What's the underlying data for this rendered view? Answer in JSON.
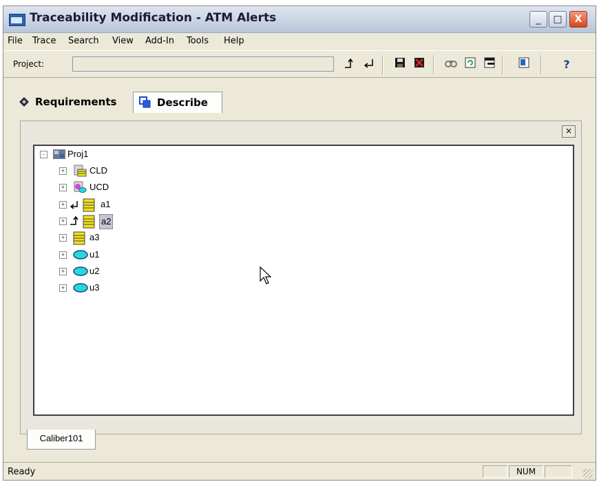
{
  "window": {
    "title": "Traceability Modification - ATM Alerts",
    "controls": {
      "minimize": "_",
      "maximize": "□",
      "close": "X"
    }
  },
  "menu": [
    "File",
    "Trace",
    "Search",
    "View",
    "Add-In",
    "Tools",
    "Help"
  ],
  "toolbar": {
    "project_label": "Project:",
    "project_value": "",
    "icons": [
      "trace-up-icon",
      "trace-down-icon",
      "save-icon",
      "delete-icon",
      "find-icon",
      "refresh-icon",
      "window-icon",
      "export-icon",
      "help-icon"
    ],
    "help_glyph": "?"
  },
  "tabs": [
    {
      "label": "Requirements",
      "icon": "diamond-icon",
      "active": false
    },
    {
      "label": "Describe",
      "icon": "describe-icon",
      "active": true
    }
  ],
  "panel": {
    "close_glyph": "×"
  },
  "tree": {
    "root": {
      "label": "Proj1",
      "icon": "project-icon",
      "expanded": true
    },
    "items": [
      {
        "label": "CLD",
        "icon": "class-diagram-icon"
      },
      {
        "label": "UCD",
        "icon": "usecase-diagram-icon"
      },
      {
        "label": "a1",
        "icon": "requirement-icon",
        "marker": "trace-down"
      },
      {
        "label": "a2",
        "icon": "requirement-icon",
        "marker": "trace-up",
        "selected": true
      },
      {
        "label": "a3",
        "icon": "requirement-icon"
      },
      {
        "label": "u1",
        "icon": "usecase-icon"
      },
      {
        "label": "u2",
        "icon": "usecase-icon"
      },
      {
        "label": "u3",
        "icon": "usecase-icon"
      }
    ],
    "expand_glyph": "+",
    "collapse_glyph": "-"
  },
  "bottom_tab": "Caliber101",
  "status": {
    "text": "Ready",
    "num": "NUM"
  },
  "colors": {
    "requirement": "#f2e21a",
    "usecase": "#29d6e0",
    "accent": "#2a63b8"
  }
}
